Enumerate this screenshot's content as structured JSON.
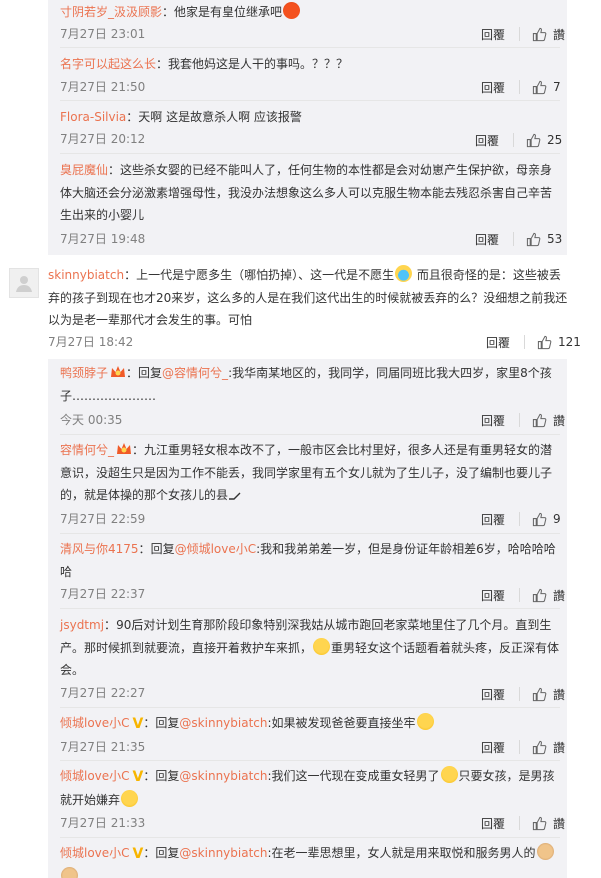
{
  "ui": {
    "reply_label": "回覆",
    "like_label": "讚"
  },
  "colors": {
    "name": "#eb7350",
    "time": "#808080",
    "panel": "#f2f2f5"
  },
  "group1": [
    {
      "name": "寸阴若岁_汲汲顾影",
      "text": "他家是有皇位继承吧",
      "time": "7月27日 23:01",
      "likes": "讚",
      "emoji": "red-face-emoji"
    },
    {
      "name": "名字可以起这么长",
      "text": "我套他妈这是人干的事吗。？？？",
      "time": "7月27日 21:50",
      "likes": "7"
    },
    {
      "name": "Flora-Silvia",
      "text": "天啊 这是故意杀人啊 应该报警",
      "time": "7月27日 20:12",
      "likes": "25"
    },
    {
      "name": "臭屁魔仙",
      "text": "这些杀女婴的已经不能叫人了，任何生物的本性都是会对幼崽产生保护欲，母亲身体大脑还会分泌激素增强母性，我没办法想象这么多人可以克服生物本能去残忍杀害自己辛苦生出来的小婴儿",
      "time": "7月27日 19:48",
      "likes": "53"
    }
  ],
  "top_comment": {
    "name": "skinnybiatch",
    "text_a": "上一代是宁愿多生（哪怕扔掉）、这一代是不愿生",
    "text_b": " 而且很奇怪的是：这些被丢弃的孩子到现在也才20来岁，这么多的人是在我们这代出生的时候就被丢弃的么？没细想之前我还以为是老一辈那代才会发生的事。可怕",
    "time": "7月27日 18:42",
    "likes": "121"
  },
  "group2": [
    {
      "name": "鸭颈脖子",
      "prefix": "回复",
      "at": "@容情何兮_",
      "text": ":我华南某地区的，我同学，同届同班比我大四岁，家里8个孩子…………………",
      "time": "今天 00:35",
      "likes": "讚"
    },
    {
      "name": "容情何兮_",
      "text": "九江重男轻女根本改不了，一般市区会比村里好，很多人还是有重男轻女的潜意识，没超生只是因为工作不能丢，我同学家里有五个女儿就为了生儿子，没了编制也要儿子的，就是体操的那个女孩儿的县",
      "time": "7月27日 22:59",
      "likes": "9"
    },
    {
      "name": "清风与你4175",
      "prefix": "回复",
      "at": "@倾城love小C",
      "text": ":我和我弟弟差一岁，但是身份证年龄相差6岁，哈哈哈哈哈",
      "time": "7月27日 22:37",
      "likes": "讚"
    },
    {
      "name": "jsydtmj",
      "text_a": "90后对计划生育那阶段印象特别深我姑从城市跑回老家菜地里住了几个月。直到生产。那时候抓到就要流，直接开着救护车来抓，",
      "text_b": "重男轻女这个话题看着就头疼，反正深有体会。",
      "time": "7月27日 22:27",
      "likes": "讚"
    },
    {
      "name": "倾城love小C",
      "prefix": "回复",
      "at": "@skinnybiatch",
      "text": ":如果被发现爸爸要直接坐牢",
      "time": "7月27日 21:35",
      "likes": "讚"
    },
    {
      "name": "倾城love小C",
      "prefix": "回复",
      "at": "@skinnybiatch",
      "text_a": ":我们这一代现在变成重女轻男了",
      "text_b": "只要女孩，是男孩就开始嫌弃",
      "time": "7月27日 21:33",
      "likes": "讚"
    },
    {
      "name": "倾城love小C",
      "prefix": "回复",
      "at": "@skinnybiatch",
      "text": ":在老一辈思想里，女人就是用来取悦和服务男人的"
    }
  ]
}
